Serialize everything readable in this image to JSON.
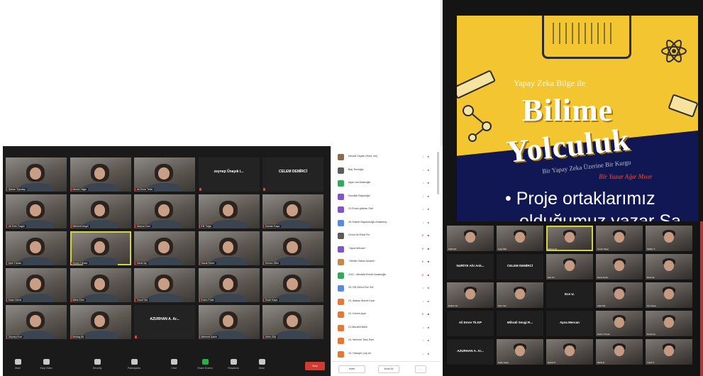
{
  "left_gallery": {
    "tiles": [
      {
        "kind": "video",
        "name": "Şahan Toprakçı"
      },
      {
        "kind": "video",
        "name": "Nesrin Yağcı"
      },
      {
        "kind": "video",
        "name": "Ali Emre Tekin"
      },
      {
        "kind": "text",
        "name": "",
        "big": "zeynep Ünayık i..."
      },
      {
        "kind": "text",
        "name": "",
        "big": "CELEM DEMİRCİ"
      },
      {
        "kind": "video",
        "name": "Ali Eren Dagür"
      },
      {
        "kind": "video",
        "name": "Mehmet Akgül"
      },
      {
        "kind": "video",
        "name": "Aleyna Cam"
      },
      {
        "kind": "video",
        "name": "Elif Tolga"
      },
      {
        "kind": "video",
        "name": "Duman Kaya"
      },
      {
        "kind": "video",
        "name": "İpek Yılmaz"
      },
      {
        "kind": "video",
        "name": "Kerim Yılmaz",
        "speaking": true
      },
      {
        "kind": "video",
        "name": "Deniz Ay"
      },
      {
        "kind": "video",
        "name": "Hazal Sezer"
      },
      {
        "kind": "video",
        "name": "Kevser Ülkü"
      },
      {
        "kind": "video",
        "name": "Kaan Demir"
      },
      {
        "kind": "video",
        "name": "Melis Eren"
      },
      {
        "kind": "video",
        "name": "Yusuf Tan"
      },
      {
        "kind": "video",
        "name": "Ecem Polat"
      },
      {
        "kind": "video",
        "name": "Sude Kaya"
      },
      {
        "kind": "video",
        "name": "Zeynep Kurt"
      },
      {
        "kind": "video",
        "name": "Berkay Ak"
      },
      {
        "kind": "text",
        "name": "",
        "big": "AZURHAN A. Ar..."
      },
      {
        "kind": "video",
        "name": "Mehmet Şahin"
      },
      {
        "kind": "video",
        "name": "Selin Gök"
      }
    ]
  },
  "toolbar": {
    "buttons": [
      {
        "label": "Mute",
        "icon": "microphone-icon"
      },
      {
        "label": "Stop Video",
        "icon": "camera-icon"
      },
      {
        "label": "Security",
        "icon": "shield-icon"
      },
      {
        "label": "Participants",
        "icon": "people-icon"
      },
      {
        "label": "Chat",
        "icon": "chat-icon"
      },
      {
        "label": "Share Screen",
        "icon": "share-screen-icon"
      },
      {
        "label": "Reactions",
        "icon": "smiley-icon"
      },
      {
        "label": "More",
        "icon": "more-icon"
      }
    ],
    "end_label": "End"
  },
  "participants": {
    "rows": [
      {
        "name": "Nevzat Ceylan (Host, me)",
        "color": "#8b6a4e",
        "red": false
      },
      {
        "name": "Bay Terzioğlu",
        "color": "#5c5c5c",
        "red": false
      },
      {
        "name": "Ayşe can Aslanoğlu",
        "color": "#3aa55c",
        "red": false
      },
      {
        "name": "Nurullah Başaroğlu",
        "color": "#7e57c2",
        "red": false
      },
      {
        "name": "22-Ercan gökhan Sivil",
        "color": "#7e57c2",
        "red": false
      },
      {
        "name": "26-Sukufe Başaranoğlu Arslanboy",
        "color": "#5b8bd6",
        "red": false
      },
      {
        "name": "Ceren Ali Erdal Fin",
        "color": "#5c5c5c",
        "red": true
      },
      {
        "name": "~Ayna Mercan~",
        "color": "#7e57c2",
        "red": true
      },
      {
        "name": "~Melike Hatice Arslanlı~",
        "color": "#c9874a",
        "red": true
      },
      {
        "name": "2101 - Mustafa Emrah Arslanoğlu",
        "color": "#3aa55c",
        "red": true
      },
      {
        "name": "25- Elif Zehra Ece Gül",
        "color": "#5b8bd6",
        "red": false
      },
      {
        "name": "23- Atakan Ahmet Kara",
        "color": "#e07a3a",
        "red": false
      },
      {
        "name": "22- Kerem Ayal",
        "color": "#e07a3a",
        "red": true
      },
      {
        "name": "21-Mücahit Balık",
        "color": "#e07a3a",
        "red": false
      },
      {
        "name": "24- Mehmet Tarık Eser",
        "color": "#e07a3a",
        "red": false
      },
      {
        "name": "19- Hüseyin Çöp Ali",
        "color": "#e07a3a",
        "red": false
      }
    ],
    "footer": {
      "invite": "Invite",
      "mute_all": "Mute All",
      "more": "..."
    }
  },
  "slide": {
    "subtitle": "Yapay Zeka Bilge ile",
    "title_line1": "Bilime",
    "title_line2": "Yolculuk",
    "subtitle2": "Bir Yapay Zeka Üzerine Bir Kurgu",
    "red_text": "Bir Yazar Ağır Mısır",
    "bullet": "• Proje ortaklarımız",
    "line2": "olduğumuz yazar Sa"
  },
  "right_gallery": {
    "tiles": [
      {
        "kind": "video",
        "name": "Fatih Ert"
      },
      {
        "kind": "video",
        "name": "Ayşe Bal"
      },
      {
        "kind": "video",
        "name": "Ahmet Uz",
        "speaking": true
      },
      {
        "kind": "video",
        "name": "Ceren Kaya"
      },
      {
        "kind": "video",
        "name": "Melike T."
      },
      {
        "kind": "text",
        "big": "NURİYE Ahi Arık...",
        "name": ""
      },
      {
        "kind": "text",
        "big": "CELEM DEMİRCİ",
        "name": ""
      },
      {
        "kind": "video",
        "name": "Ece Kır"
      },
      {
        "kind": "video",
        "name": "Sena Aydın"
      },
      {
        "kind": "video",
        "name": "Bora Ak"
      },
      {
        "kind": "video",
        "name": "Erdem Sır"
      },
      {
        "kind": "video",
        "name": "İrem Yaz"
      },
      {
        "kind": "text",
        "big": "Ece U.",
        "name": ""
      },
      {
        "kind": "video",
        "name": "Ayla Tok"
      },
      {
        "kind": "video",
        "name": "Nur Kaya"
      },
      {
        "kind": "text",
        "big": "Ali Emre Tk.KP",
        "name": ""
      },
      {
        "kind": "text",
        "big": "Mihrali Sevgi R...",
        "name": ""
      },
      {
        "kind": "text",
        "big": "Ayna Mercan",
        "name": ""
      },
      {
        "kind": "video",
        "name": "Kerim Yılmaz"
      },
      {
        "kind": "video",
        "name": "Deniz Ay"
      },
      {
        "kind": "text",
        "big": "AZURHAN A. Ar...",
        "name": ""
      },
      {
        "kind": "video",
        "name": "Sude Kaya"
      },
      {
        "kind": "video",
        "name": "Hazal Ö."
      },
      {
        "kind": "video",
        "name": "Melis E."
      },
      {
        "kind": "video",
        "name": "Yusuf T."
      }
    ]
  },
  "colors": {
    "zoom_bg": "#1a1a1a",
    "slide_yellow": "#f2c531",
    "slide_navy": "#101752",
    "end_red": "#d33a32",
    "speaker_outline": "#d7d33a"
  }
}
